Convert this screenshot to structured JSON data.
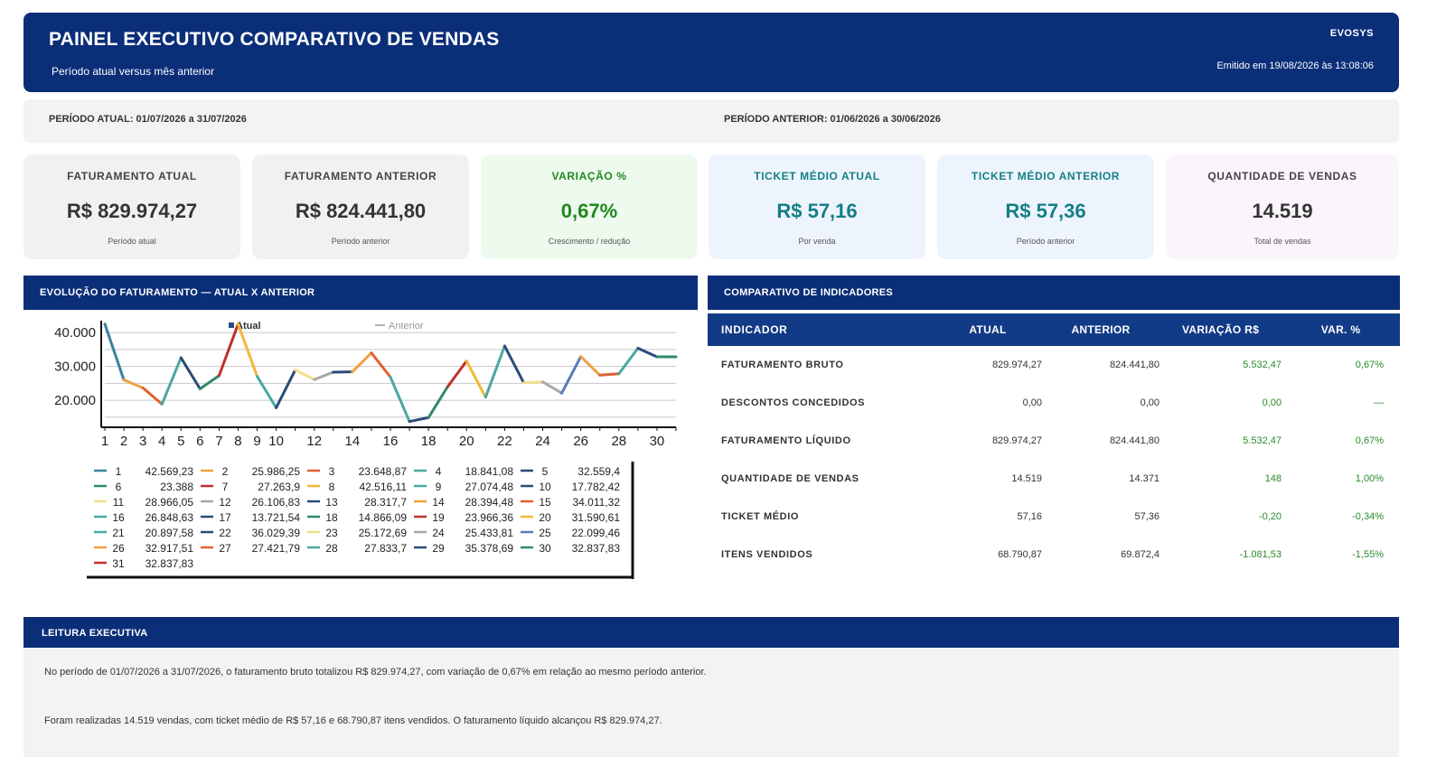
{
  "header": {
    "title": "PAINEL EXECUTIVO COMPARATIVO DE VENDAS",
    "subtitle": "Período atual versus mês anterior",
    "brand": "EVOSYS",
    "emitted": "Emitido em 19/08/2026 às 13:08:06"
  },
  "periods": {
    "current": "PERÍODO ATUAL: 01/07/2026 a 31/07/2026",
    "previous": "PERÍODO ANTERIOR: 01/06/2026 a 30/06/2026"
  },
  "kpis": [
    {
      "label": "FATURAMENTO ATUAL",
      "value": "R$ 829.974,27",
      "note": "Período atual",
      "bg": "#f1f1f1",
      "color": "#333333",
      "label_color": "#444444"
    },
    {
      "label": "FATURAMENTO ANTERIOR",
      "value": "R$ 824.441,80",
      "note": "Período anterior",
      "bg": "#f1f1f1",
      "color": "#333333",
      "label_color": "#444444"
    },
    {
      "label": "VARIAÇÃO %",
      "value": "0,67%",
      "note": "Crescimento / redução",
      "bg": "#eefaee",
      "color": "#1e8a1e",
      "label_color": "#1e8a1e"
    },
    {
      "label": "TICKET MÉDIO ATUAL",
      "value": "R$ 57,16",
      "note": "Por venda",
      "bg": "#eef4fd",
      "color": "#147f86",
      "label_color": "#147f86"
    },
    {
      "label": "TICKET MÉDIO ANTERIOR",
      "value": "R$ 57,36",
      "note": "Período anterior",
      "bg": "#eef4fd",
      "color": "#147f86",
      "label_color": "#147f86"
    },
    {
      "label": "QUANTIDADE DE VENDAS",
      "value": "14.519",
      "note": "Total de vendas",
      "bg": "#faf5fb",
      "color": "#333333",
      "label_color": "#444444"
    }
  ],
  "sections": {
    "chart": "EVOLUÇÃO DO FATURAMENTO — ATUAL X ANTERIOR",
    "indicators": "COMPARATIVO DE INDICADORES",
    "reading": "LEITURA EXECUTIVA"
  },
  "chart_data": {
    "type": "line",
    "x": [
      1,
      2,
      3,
      4,
      5,
      6,
      7,
      8,
      9,
      10,
      11,
      12,
      13,
      14,
      15,
      16,
      17,
      18,
      19,
      20,
      21,
      22,
      23,
      24,
      25,
      26,
      27,
      28,
      29,
      30,
      31
    ],
    "x_tick_labels": [
      "1",
      "2",
      "3",
      "4",
      "5",
      "6",
      "7",
      "8",
      "9",
      "10",
      "12",
      "14",
      "16",
      "18",
      "20",
      "22",
      "24",
      "26",
      "28",
      "30"
    ],
    "y_tick_labels": [
      "40.000",
      "30.000",
      "20.000"
    ],
    "ylim": [
      12000,
      43000
    ],
    "grid": true,
    "header_legend": [
      "Atual",
      "Anterior"
    ],
    "series": [
      {
        "name": "Atual",
        "values": [
          42569.23,
          25986.25,
          23648.87,
          18841.08,
          32559.4,
          23388,
          27263.9,
          42516.11,
          27074.48,
          17782.42,
          28966.05,
          26106.83,
          28317.7,
          28394.48,
          34011.32,
          26848.63,
          13721.54,
          14866.09,
          23966.36,
          31590.61,
          20897.58,
          36029.39,
          25172.69,
          25433.81,
          22099.46,
          32917.51,
          27421.79,
          27833.7,
          35378.69,
          32837.83,
          32837.83
        ]
      }
    ],
    "legend": [
      {
        "day": "1",
        "value": "42.569,23"
      },
      {
        "day": "2",
        "value": "25.986,25"
      },
      {
        "day": "3",
        "value": "23.648,87"
      },
      {
        "day": "4",
        "value": "18.841,08"
      },
      {
        "day": "5",
        "value": "32.559,4"
      },
      {
        "day": "6",
        "value": "23.388"
      },
      {
        "day": "7",
        "value": "27.263,9"
      },
      {
        "day": "8",
        "value": "42.516,11"
      },
      {
        "day": "9",
        "value": "27.074,48"
      },
      {
        "day": "10",
        "value": "17.782,42"
      },
      {
        "day": "11",
        "value": "28.966,05"
      },
      {
        "day": "12",
        "value": "26.106,83"
      },
      {
        "day": "13",
        "value": "28.317,7"
      },
      {
        "day": "14",
        "value": "28.394,48"
      },
      {
        "day": "15",
        "value": "34.011,32"
      },
      {
        "day": "16",
        "value": "26.848,63"
      },
      {
        "day": "17",
        "value": "13.721,54"
      },
      {
        "day": "18",
        "value": "14.866,09"
      },
      {
        "day": "19",
        "value": "23.966,36"
      },
      {
        "day": "20",
        "value": "31.590,61"
      },
      {
        "day": "21",
        "value": "20.897,58"
      },
      {
        "day": "22",
        "value": "36.029,39"
      },
      {
        "day": "23",
        "value": "25.172,69"
      },
      {
        "day": "24",
        "value": "25.433,81"
      },
      {
        "day": "25",
        "value": "22.099,46"
      },
      {
        "day": "26",
        "value": "32.917,51"
      },
      {
        "day": "27",
        "value": "27.421,79"
      },
      {
        "day": "28",
        "value": "27.833,7"
      },
      {
        "day": "29",
        "value": "35.378,69"
      },
      {
        "day": "30",
        "value": "32.837,83"
      },
      {
        "day": "31",
        "value": "32.837,83"
      }
    ],
    "palette": [
      "#3c7f9f",
      "#f0a040",
      "#e06030",
      "#4aa8a0",
      "#2b4a7a",
      "#2f8a6a",
      "#c0302a",
      "#f2b838",
      "#4aa8a0",
      "#2b4a7a",
      "#f2e08a",
      "#a8a8a8",
      "#2b4a7a",
      "#f0a040",
      "#e06030",
      "#4aa8a0",
      "#2b4a7a",
      "#2f8a6a",
      "#c0302a",
      "#f2b838",
      "#4aa8a0",
      "#2b4a7a",
      "#f2e08a",
      "#a8a8a8",
      "#5a7ab8",
      "#f0a040",
      "#e06030",
      "#4aa8a0",
      "#2b4a7a",
      "#2f8a6a",
      "#c0302a"
    ]
  },
  "indicators": {
    "columns": [
      "INDICADOR",
      "ATUAL",
      "ANTERIOR",
      "VARIAÇÃO R$",
      "VAR. %"
    ],
    "rows": [
      {
        "name": "FATURAMENTO BRUTO",
        "current": "829.974,27",
        "previous": "824.441,80",
        "var": "5.532,47",
        "pct": "0,67%"
      },
      {
        "name": "DESCONTOS CONCEDIDOS",
        "current": "0,00",
        "previous": "0,00",
        "var": "0,00",
        "pct": "—"
      },
      {
        "name": "FATURAMENTO LÍQUIDO",
        "current": "829.974,27",
        "previous": "824.441,80",
        "var": "5.532,47",
        "pct": "0,67%"
      },
      {
        "name": "QUANTIDADE DE VENDAS",
        "current": "14.519",
        "previous": "14.371",
        "var": "148",
        "pct": "1,00%"
      },
      {
        "name": "TICKET MÉDIO",
        "current": "57,16",
        "previous": "57,36",
        "var": "-0,20",
        "pct": "-0,34%"
      },
      {
        "name": "ITENS VENDIDOS",
        "current": "68.790,87",
        "previous": "69.872,4",
        "var": "-1.081,53",
        "pct": "-1,55%"
      }
    ]
  },
  "reading": {
    "p1": "No período de 01/07/2026 a 31/07/2026, o faturamento bruto totalizou R$ 829.974,27, com variação de 0,67% em relação ao mesmo período anterior.",
    "p2": "Foram realizadas 14.519 vendas, com ticket médio de R$ 57,16 e 68.790,87 itens vendidos. O faturamento líquido alcançou R$ 829.974,27."
  }
}
